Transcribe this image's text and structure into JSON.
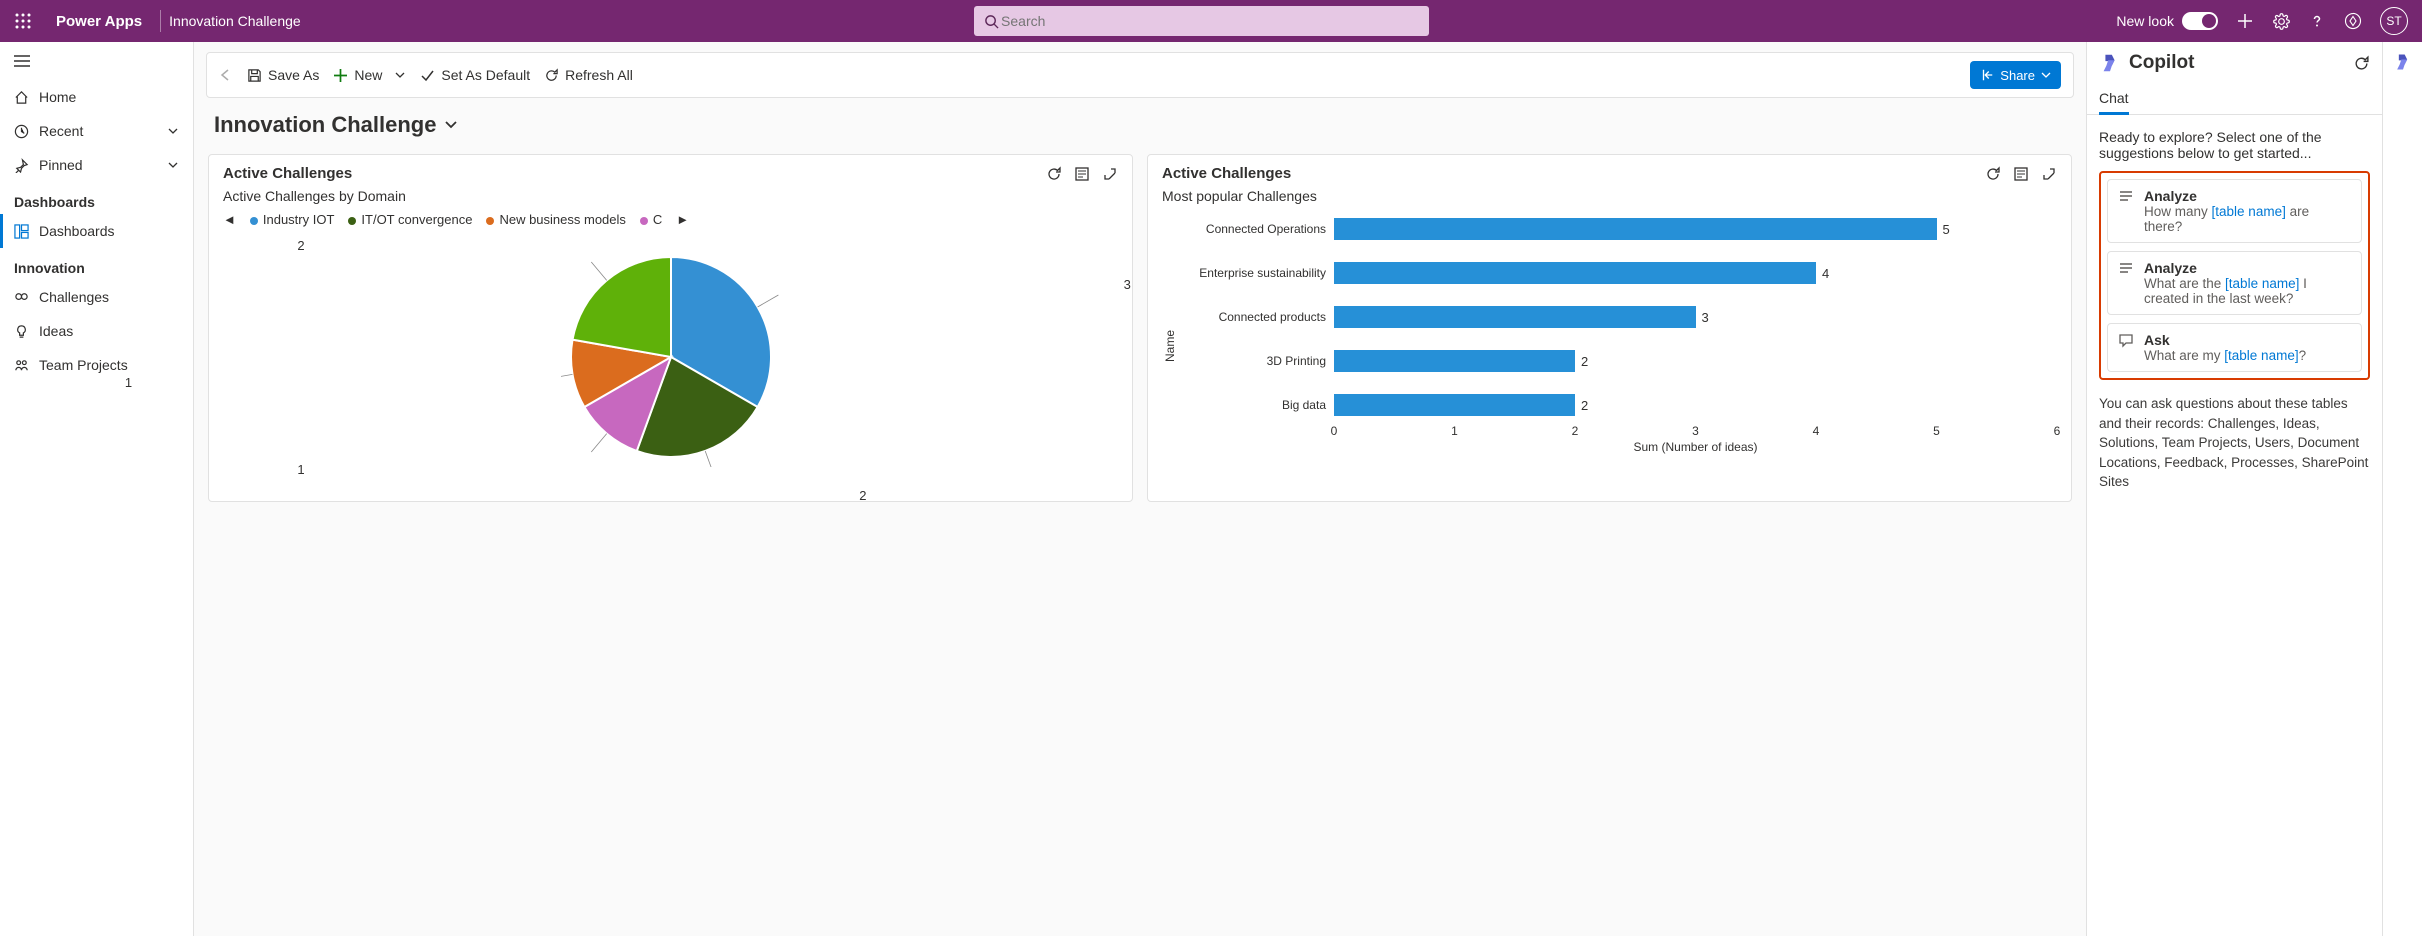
{
  "header": {
    "brand": "Power Apps",
    "app": "Innovation Challenge",
    "search_placeholder": "Search",
    "newlook": "New look",
    "avatar": "ST"
  },
  "sidebar": {
    "home": "Home",
    "recent": "Recent",
    "pinned": "Pinned",
    "sec_dash": "Dashboards",
    "dashboards": "Dashboards",
    "sec_inno": "Innovation",
    "challenges": "Challenges",
    "ideas": "Ideas",
    "team_projects": "Team Projects"
  },
  "cmdbar": {
    "save_as": "Save As",
    "new": "New",
    "set_default": "Set As Default",
    "refresh": "Refresh All",
    "share": "Share"
  },
  "page_title": "Innovation Challenge",
  "card1": {
    "title": "Active Challenges",
    "subtitle": "Active Challenges by Domain",
    "legend": [
      "Industry IOT",
      "IT/OT convergence",
      "New business models",
      "C"
    ]
  },
  "card2": {
    "title": "Active Challenges",
    "subtitle": "Most popular Challenges",
    "ylabel": "Name",
    "xlabel": "Sum (Number of ideas)"
  },
  "chart_data": [
    {
      "type": "pie",
      "title": "Active Challenges by Domain",
      "series": [
        {
          "name": "Industry IOT",
          "value": 3,
          "color": "#3490d3"
        },
        {
          "name": "IT/OT convergence",
          "value": 2,
          "color": "#3b6013"
        },
        {
          "name": "New business models",
          "value": 1,
          "color": "#c768bf"
        },
        {
          "name": "(orange segment)",
          "value": 1,
          "color": "#db6c1e"
        },
        {
          "name": "(green segment)",
          "value": 2,
          "color": "#5fb109"
        }
      ]
    },
    {
      "type": "bar",
      "title": "Most popular Challenges",
      "orientation": "horizontal",
      "xlabel": "Sum (Number of ideas)",
      "ylabel": "Name",
      "xlim": [
        0,
        6
      ],
      "xticks": [
        0,
        1,
        2,
        3,
        4,
        5,
        6
      ],
      "categories": [
        "Connected Operations",
        "Enterprise sustainability",
        "Connected products",
        "3D Printing",
        "Big data"
      ],
      "values": [
        5,
        4,
        3,
        2,
        2
      ]
    }
  ],
  "copilot": {
    "title": "Copilot",
    "tab": "Chat",
    "prompt": "Ready to explore? Select one of the suggestions below to get started...",
    "sug1_t": "Analyze",
    "sug1_b_pre": "How many ",
    "sug1_b_br": "[table name]",
    "sug1_b_post": " are there?",
    "sug2_t": "Analyze",
    "sug2_b_pre": "What are the ",
    "sug2_b_br": "[table name]",
    "sug2_b_post": " I created in the last week?",
    "sug3_t": "Ask",
    "sug3_b_pre": "What are my ",
    "sug3_b_br": "[table name]",
    "sug3_b_post": "?",
    "footer": "You can ask questions about these tables and their records: Challenges, Ideas, Solutions, Team Projects, Users, Document Locations, Feedback, Processes, SharePoint Sites"
  }
}
